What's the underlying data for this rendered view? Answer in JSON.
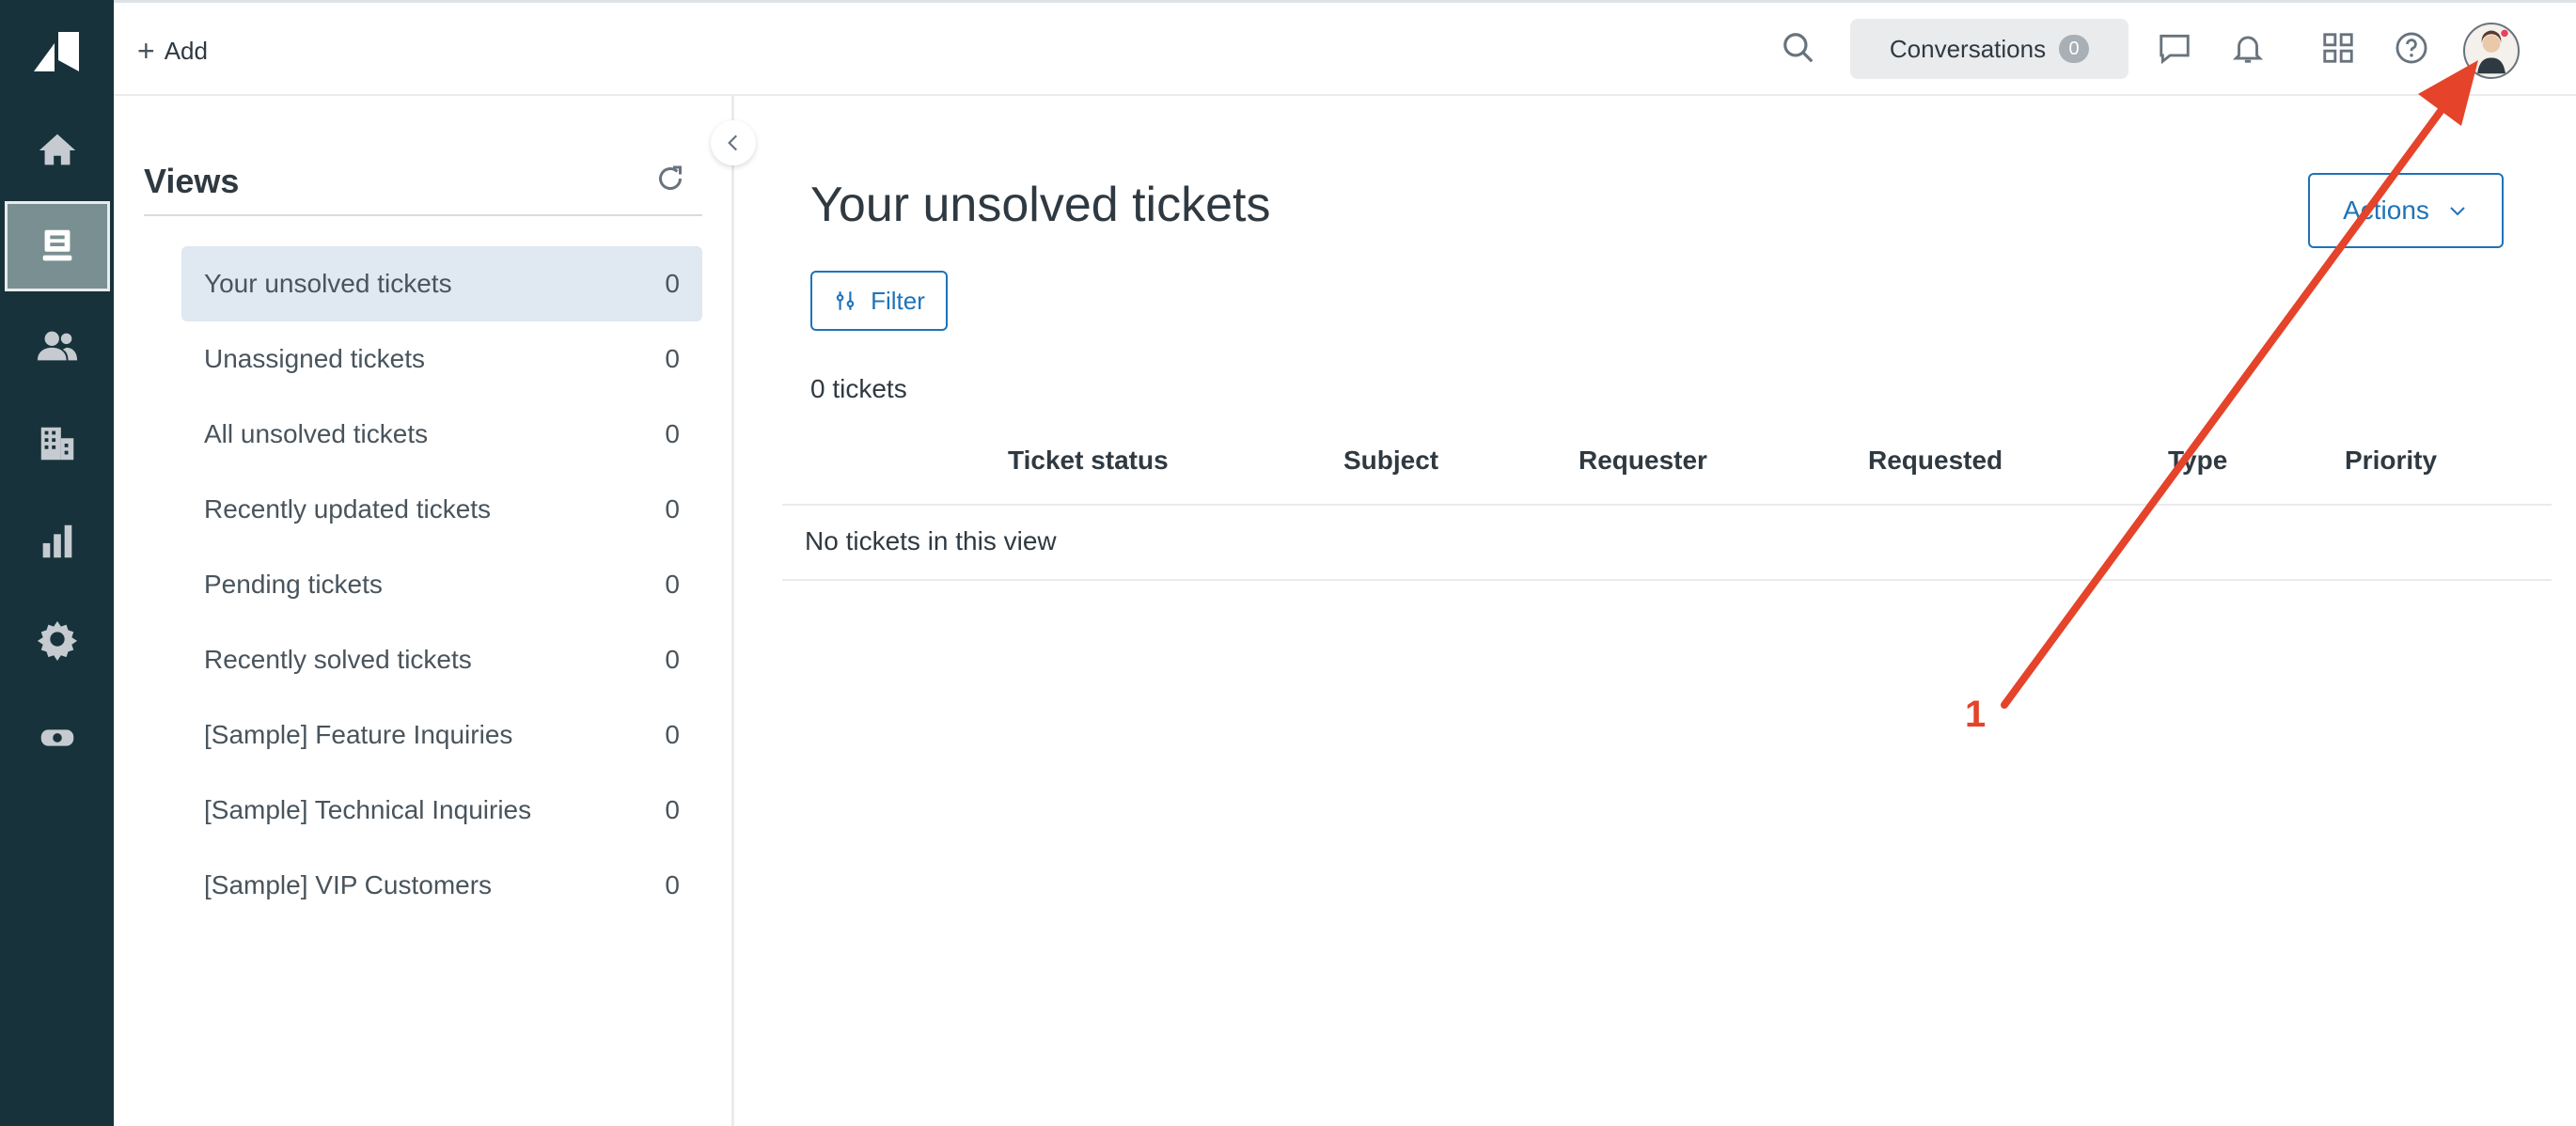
{
  "topbar": {
    "add_label": "Add",
    "conversations_label": "Conversations",
    "conversations_count": "0"
  },
  "nav": {
    "items": [
      "home-icon",
      "tickets-icon",
      "customers-icon",
      "organizations-icon",
      "reporting-icon",
      "admin-icon",
      "apps-icon"
    ],
    "active": "tickets-icon"
  },
  "views": {
    "title": "Views",
    "items": [
      {
        "label": "Your unsolved tickets",
        "count": "0"
      },
      {
        "label": "Unassigned tickets",
        "count": "0"
      },
      {
        "label": "All unsolved tickets",
        "count": "0"
      },
      {
        "label": "Recently updated tickets",
        "count": "0"
      },
      {
        "label": "Pending tickets",
        "count": "0"
      },
      {
        "label": "Recently solved tickets",
        "count": "0"
      },
      {
        "label": "[Sample] Feature Inquiries",
        "count": "0"
      },
      {
        "label": "[Sample] Technical Inquiries",
        "count": "0"
      },
      {
        "label": "[Sample] VIP Customers",
        "count": "0"
      }
    ]
  },
  "main": {
    "title": "Your unsolved tickets",
    "actions_label": "Actions",
    "filter_label": "Filter",
    "ticket_count": "0 tickets",
    "columns": [
      "Ticket status",
      "Subject",
      "Requester",
      "Requested",
      "Type",
      "Priority"
    ],
    "empty_message": "No tickets in this view"
  },
  "annotation": {
    "label": "1"
  },
  "colors": {
    "nav_bg": "#17323a",
    "accent": "#1f73b7",
    "active_row": "#e0e8f2",
    "annotation": "#e5432a"
  }
}
